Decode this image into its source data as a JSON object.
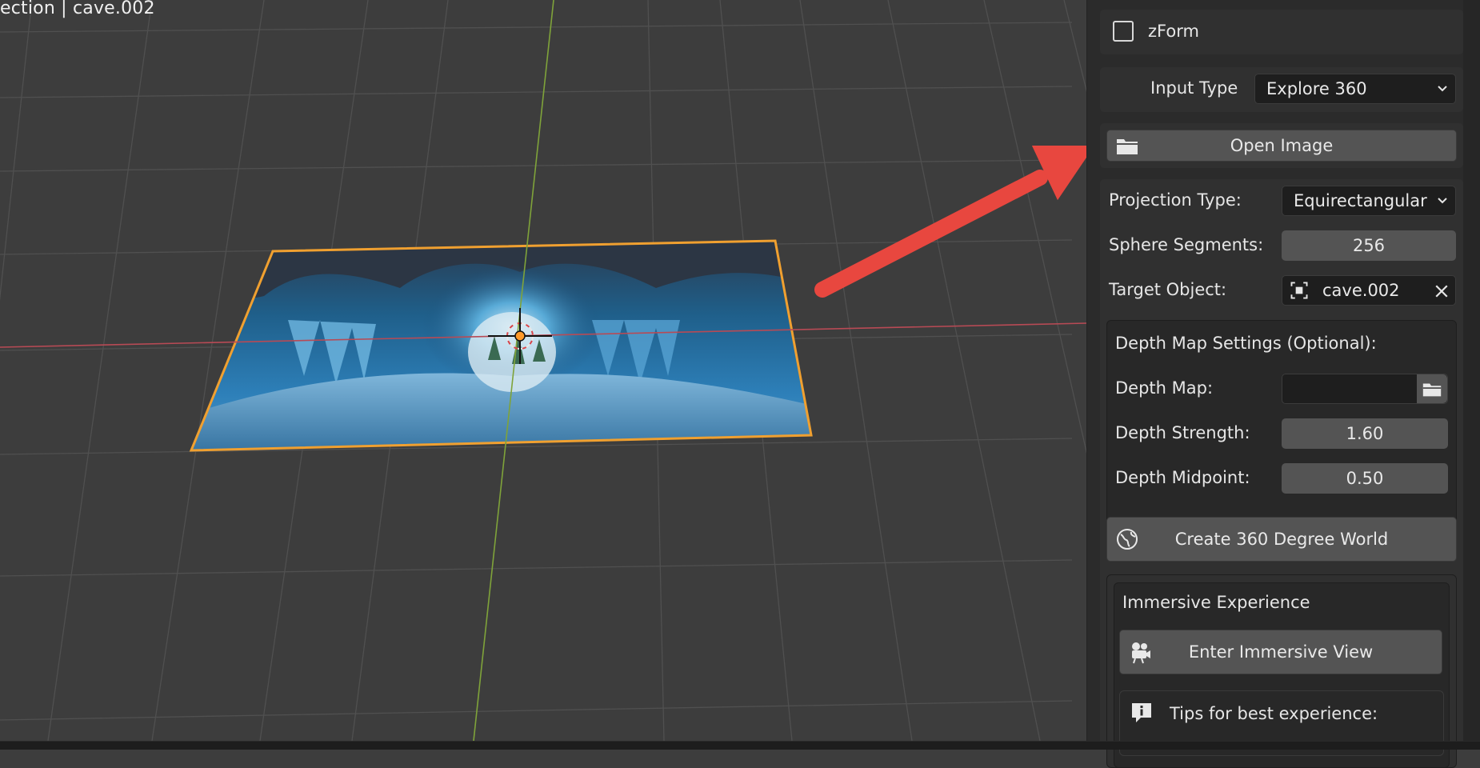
{
  "viewport": {
    "title": "ection | cave.002"
  },
  "panel": {
    "zform_label": "zForm",
    "input_type_label": "Input Type",
    "input_type_value": "Explore 360",
    "open_image_label": "Open Image",
    "projection_type_label": "Projection Type:",
    "projection_type_value": "Equirectangular",
    "sphere_segments_label": "Sphere Segments:",
    "sphere_segments_value": "256",
    "target_object_label": "Target Object:",
    "target_object_value": "cave.002",
    "depth": {
      "heading": "Depth Map Settings (Optional):",
      "map_label": "Depth Map:",
      "strength_label": "Depth Strength:",
      "strength_value": "1.60",
      "midpoint_label": "Depth Midpoint:",
      "midpoint_value": "0.50"
    },
    "create_world_label": "Create 360 Degree World",
    "immersive": {
      "heading": "Immersive Experience",
      "enter_label": "Enter Immersive View",
      "tips_label": "Tips for best experience:"
    }
  },
  "icons": [
    "folder-icon",
    "globe-icon",
    "camera-icon",
    "info-icon",
    "chevron-down-icon",
    "close-icon",
    "object-icon",
    "checkbox-icon"
  ],
  "colors": {
    "accent_arrow": "#e8473f",
    "selection_outline": "#f0a030",
    "y_axis": "#7fa33a",
    "x_axis": "#b84a55"
  }
}
